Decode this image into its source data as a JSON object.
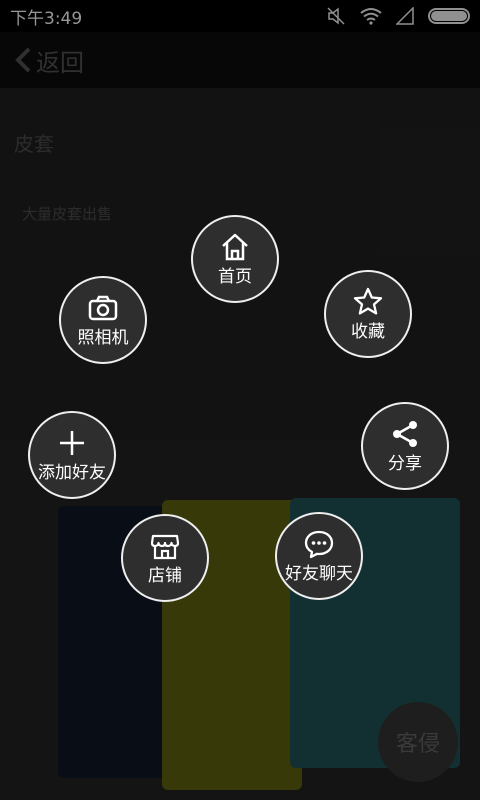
{
  "status_bar": {
    "time": "下午3:49"
  },
  "app_bar": {
    "back_label": "返回"
  },
  "content": {
    "title": "皮套",
    "description": "大量皮套出售",
    "watermark": "客侵"
  },
  "menu": {
    "home": "首页",
    "camera": "照相机",
    "favorite": "收藏",
    "add_friend": "添加好友",
    "share": "分享",
    "store": "店铺",
    "chat": "好友聊天"
  }
}
